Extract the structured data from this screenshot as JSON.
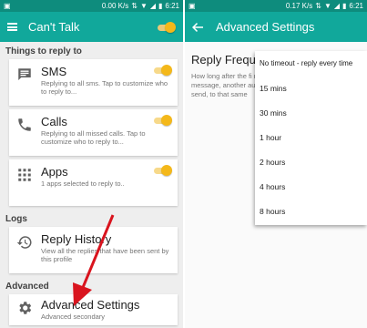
{
  "left": {
    "status": {
      "speed": "0.00 K/s",
      "time": "6:21"
    },
    "appbar": {
      "title": "Can't Talk"
    },
    "sections": {
      "reply": "Things to reply to",
      "logs": "Logs",
      "advanced": "Advanced"
    },
    "cards": {
      "sms": {
        "title": "SMS",
        "subtitle": "Replying to all sms. Tap to customize who to reply to..."
      },
      "calls": {
        "title": "Calls",
        "subtitle": "Replying to all missed calls. Tap to customize who to reply to..."
      },
      "apps": {
        "title": "Apps",
        "subtitle": "1 apps selected to reply to.."
      },
      "history": {
        "title": "Reply History",
        "subtitle": "View all the replies that have been sent by this profile"
      },
      "advanced": {
        "title": "Advanced Settings",
        "subtitle": "Advanced secondary"
      }
    }
  },
  "right": {
    "status": {
      "speed": "0.17 K/s",
      "time": "6:21"
    },
    "appbar": {
      "title": "Advanced Settings"
    },
    "setting": {
      "title": "Reply Freque",
      "description": "How long after the fi reply to a message, another auto reply be to send, to that same"
    },
    "dropdown": [
      "No timeout - reply every time",
      "15 mins",
      "30 mins",
      "1 hour",
      "2 hours",
      "4 hours",
      "8 hours"
    ]
  },
  "colors": {
    "statusbar": "#0e8c7d",
    "appbar": "#11a89b",
    "toggle": "#f4b81a",
    "arrow": "#d9141e"
  }
}
